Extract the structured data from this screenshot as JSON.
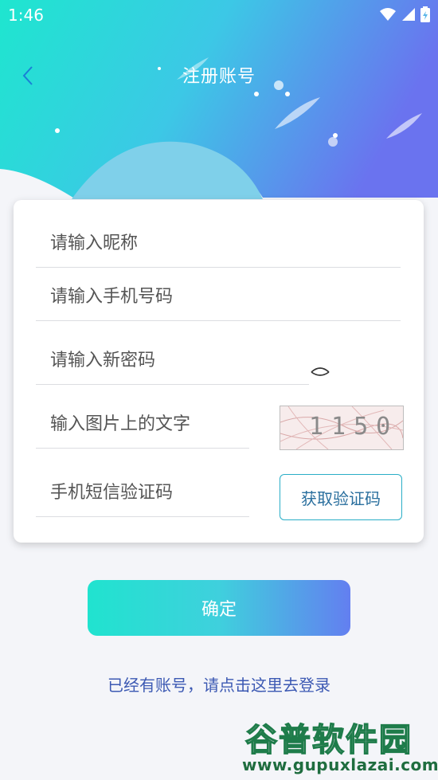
{
  "status_bar": {
    "time": "1:46"
  },
  "header": {
    "title": "注册账号"
  },
  "form": {
    "nickname_placeholder": "请输入昵称",
    "phone_placeholder": "请输入手机号码",
    "password_placeholder": "请输入新密码",
    "captcha_placeholder": "输入图片上的文字",
    "captcha_value": "1150",
    "sms_placeholder": "手机短信验证码",
    "sms_button_label": "获取验证码"
  },
  "confirm_label": "确定",
  "login_link": "已经有账号，请点击这里去登录",
  "watermark": {
    "title": "谷普软件园",
    "url": "www.gupuxlazai.com"
  },
  "colors": {
    "gradient_start": "#20e3cf",
    "gradient_end": "#637ff0",
    "link": "#3c59b3",
    "sms_border": "#2aaec7"
  }
}
